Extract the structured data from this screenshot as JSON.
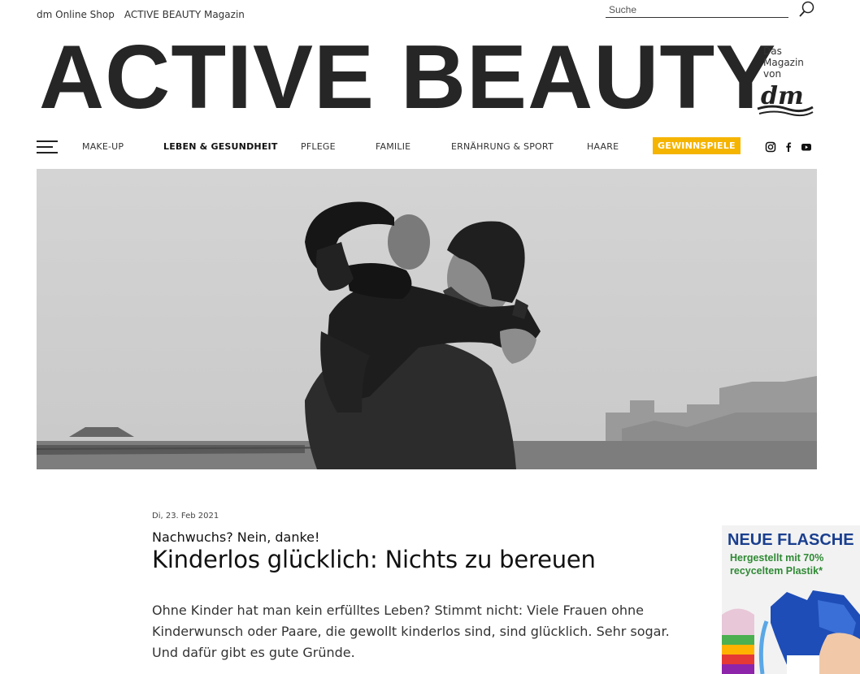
{
  "top_links": [
    "dm Online Shop",
    "ACTIVE BEAUTY Magazin"
  ],
  "search": {
    "placeholder": "Suche"
  },
  "logo": {
    "title": "ACTIVE BEAUTY",
    "byline": [
      "Das",
      "Magazin",
      "von"
    ],
    "brand": "dm"
  },
  "nav": {
    "items": [
      "MAKE-UP",
      "LEBEN & GESUNDHEIT",
      "PFLEGE",
      "FAMILIE",
      "ERNÄHRUNG & SPORT",
      "HAARE"
    ],
    "highlight": "GEWINNSPIELE",
    "social": [
      "instagram-icon",
      "facebook-icon",
      "youtube-icon"
    ]
  },
  "colors": {
    "highlight": "#f5b400",
    "ad_blue": "#1a3f8f",
    "ad_green": "#2f8a34"
  },
  "article": {
    "date": "Di, 23. Feb 2021",
    "kicker": "Nachwuchs? Nein, danke!",
    "headline": "Kinderlos glücklich: Nichts zu bereuen",
    "lead": "Ohne Kinder hat man kein erfülltes Leben? Stimmt nicht: Viele Frauen ohne Kinderwunsch oder Paare, die gewollt kinderlos sind, sind glücklich. Sehr sogar. Und dafür gibt es gute Gründe."
  },
  "ad": {
    "title": "NEUE FLASCHE",
    "subtitle_line1": "Hergestellt mit 70%",
    "subtitle_line2": "recyceltem Plastik*"
  }
}
